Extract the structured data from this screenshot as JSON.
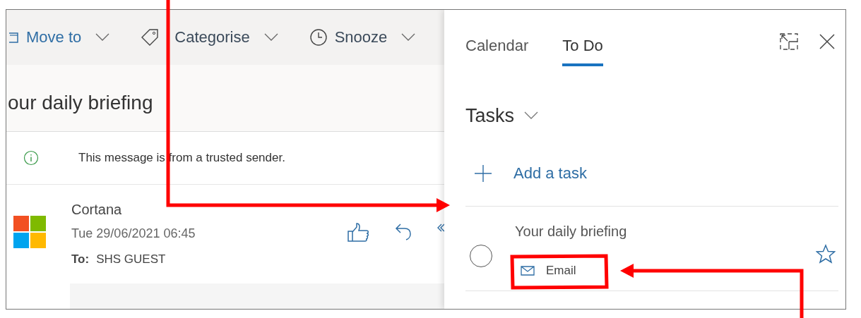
{
  "toolbar": [
    {
      "label": "Move to"
    },
    {
      "label": "Categorise"
    },
    {
      "label": "Snooze"
    }
  ],
  "message": {
    "title": "our daily briefing",
    "notice": "This message is from a trusted sender.",
    "sender": "Cortana",
    "date": "Tue 29/06/2021 06:45",
    "to_label": "To:",
    "to": "SHS GUEST"
  },
  "panel": {
    "tabs": [
      {
        "label": "Calendar",
        "selected": false
      },
      {
        "label": "To Do",
        "selected": true
      }
    ],
    "list_title": "Tasks",
    "add_task": "Add a task",
    "tasks": [
      {
        "title": "Your daily briefing",
        "source": "Email",
        "completed": false,
        "important": false
      }
    ]
  }
}
